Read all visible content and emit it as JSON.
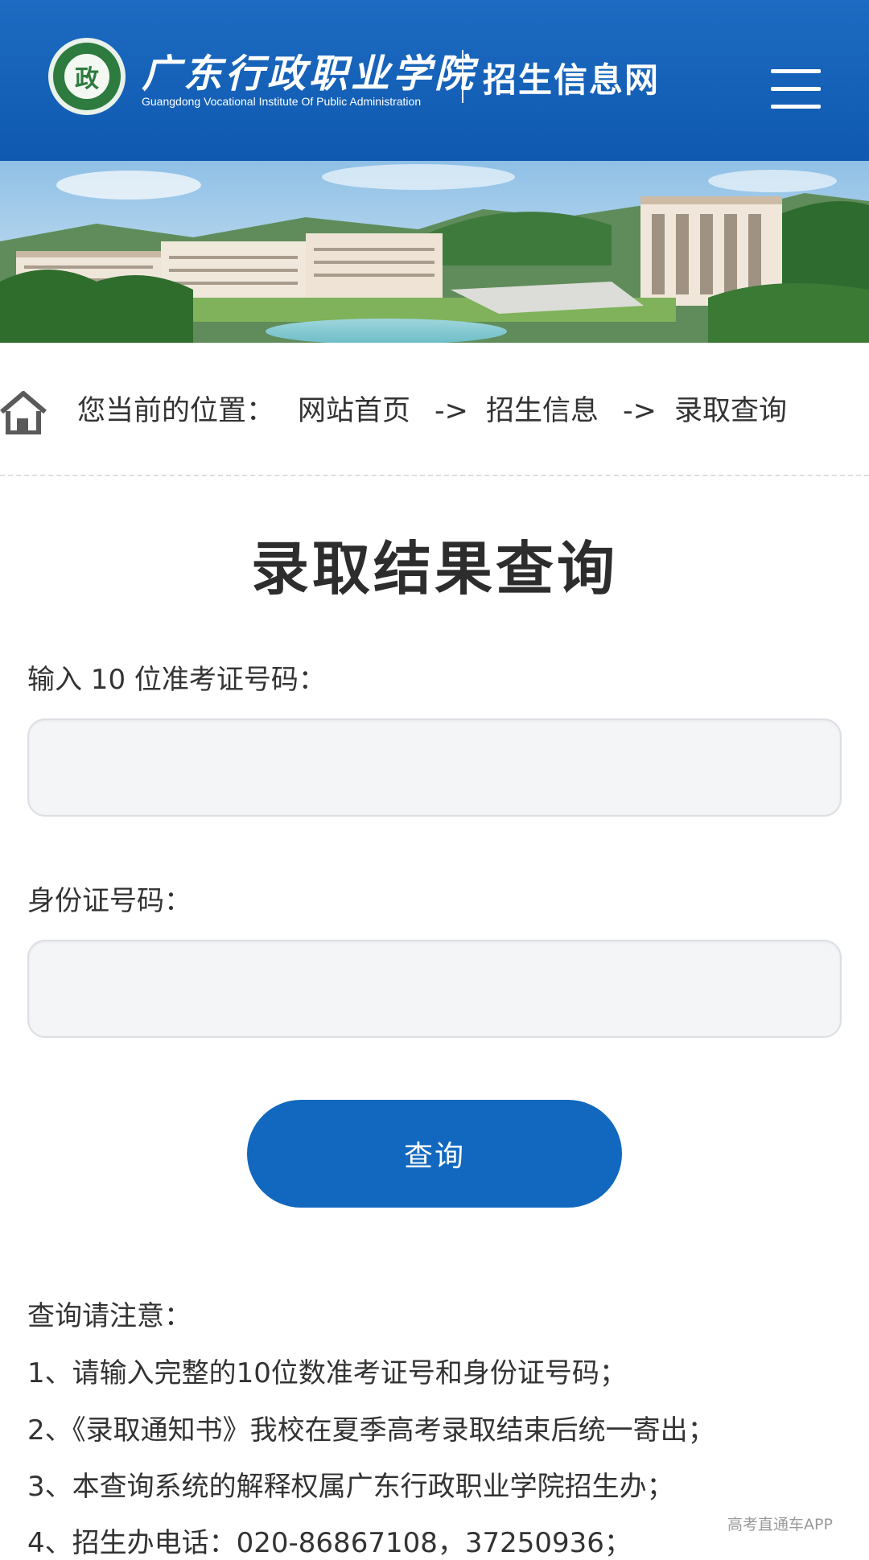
{
  "header": {
    "logo_emblem_text": "政",
    "school_name_cn": "广东行政职业学院",
    "school_name_en": "Guangdong Vocational Institute Of Public Administration",
    "site_name": "招生信息网",
    "brand_color": "#1168be"
  },
  "breadcrumb": {
    "prefix": "您当前的位置：",
    "items": [
      "网站首页",
      "招生信息",
      "录取查询"
    ],
    "separator": "->"
  },
  "main": {
    "title": "录取结果查询",
    "exam_label": "输入 10 位准考证号码：",
    "exam_value": "",
    "id_label": "身份证号码：",
    "id_value": "",
    "submit_label": "查询"
  },
  "notes": {
    "title": "查询请注意：",
    "items": [
      "1、请输入完整的10位数准考证号和身份证号码；",
      "2、《录取通知书》我校在夏季高考录取结束后统一寄出；",
      "3、本查询系统的解释权属广东行政职业学院招生办；",
      "4、招生办电话：020-86867108，37250936；"
    ]
  },
  "watermark": "高考直通车APP"
}
